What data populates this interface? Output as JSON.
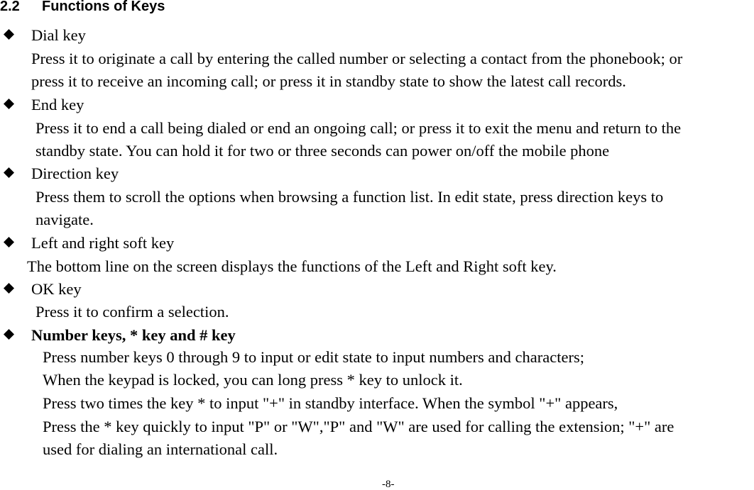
{
  "section": {
    "number": "2.2",
    "title": "Functions of Keys"
  },
  "items": [
    {
      "label": "Dial key",
      "lines": [
        "Press it to originate a call by entering the called number or selecting a contact from the phonebook; or",
        "press it to receive an incoming call; or press it in standby state to show the latest call records."
      ]
    },
    {
      "label": "End key",
      "lines": [
        "Press it to end a call being dialed or end an ongoing call; or press it to exit the menu and return to the",
        "standby state. You can hold it for two or three seconds can power on/off the mobile phone"
      ]
    },
    {
      "label": "Direction key",
      "lines": [
        "Press them to scroll the options when browsing a function list. In edit state, press direction keys to",
        "navigate."
      ]
    },
    {
      "label": "Left and right soft key",
      "lines": [
        "The bottom line on the screen displays the functions of the Left and Right soft key."
      ]
    },
    {
      "label": "OK key",
      "lines": [
        "Press it to confirm a selection."
      ]
    },
    {
      "label": "Number keys, * key and # key",
      "lines": [
        "Press number keys 0 through 9 to input or edit state to input numbers and characters;",
        "When the keypad is locked, you can long press * key to unlock it.",
        "Press two times the key * to input \"+\" in standby interface. When the symbol \"+\" appears,",
        "Press the * key quickly to input \"P\" or \"W\",\"P\" and \"W\" are used for calling the extension; \"+\" are",
        "used for dialing an international call."
      ]
    }
  ],
  "footer": {
    "page_number": "-8-"
  }
}
